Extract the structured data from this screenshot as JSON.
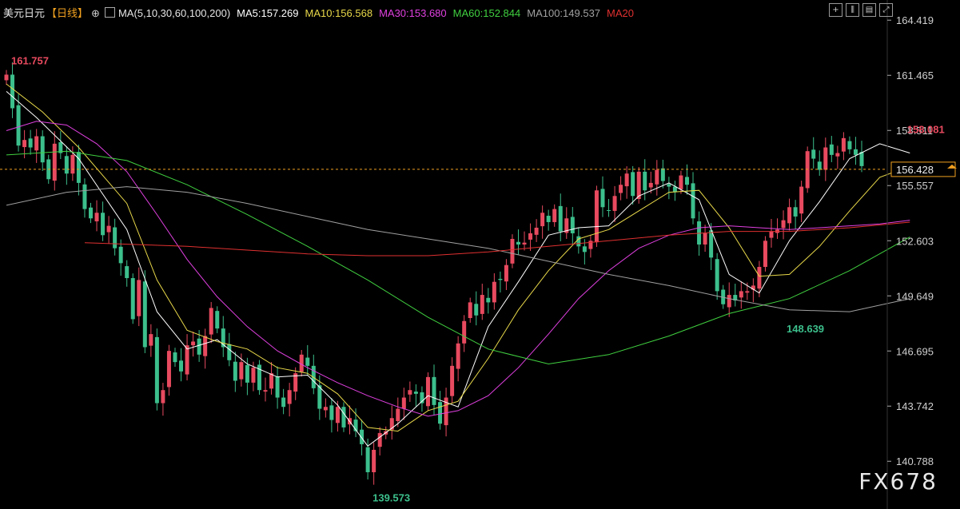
{
  "header": {
    "pair": "美元日元",
    "period": "【日线】",
    "ma_title": "MA(5,10,30,60,100,200)",
    "ma_values": [
      {
        "label": "MA5:157.269",
        "color": "#ffffff"
      },
      {
        "label": "MA10:156.568",
        "color": "#e8d84a"
      },
      {
        "label": "MA30:153.680",
        "color": "#e040e0"
      },
      {
        "label": "MA60:152.844",
        "color": "#40d040"
      },
      {
        "label": "MA100:149.537",
        "color": "#a0a0a0"
      },
      {
        "label": "MA20",
        "color": "#e03030"
      }
    ]
  },
  "toolbar": [
    "plus-square-icon",
    "bars-icon",
    "chart-icon",
    "expand-icon"
  ],
  "watermark": "FX678",
  "colors": {
    "up": "#e84a5f",
    "down": "#3cbf8c",
    "price_line": "#f0a020",
    "bg": "#000000"
  },
  "chart_data": {
    "type": "candlestick",
    "ylim": [
      139.3,
      164.9
    ],
    "y_ticks": [
      "164.419",
      "161.465",
      "158.511",
      "155.557",
      "152.603",
      "149.649",
      "146.695",
      "143.742",
      "140.788"
    ],
    "current_price": "156.428",
    "annotations": [
      {
        "text": "161.757",
        "value": 161.757,
        "index": 0,
        "color": "#e84a5f"
      },
      {
        "text": "139.573",
        "value": 139.573,
        "index": 60,
        "color": "#3cbf8c"
      },
      {
        "text": "148.639",
        "value": 148.639,
        "index": 129,
        "color": "#3cbf8c"
      },
      {
        "text": "158.081",
        "value": 158.081,
        "index": 149,
        "color": "#e84a5f"
      }
    ],
    "closes": [
      161.5,
      159.7,
      157.7,
      158.0,
      157.6,
      158.2,
      156.8,
      155.9,
      157.8,
      157.3,
      156.2,
      157.2,
      155.7,
      154.3,
      153.8,
      154.1,
      152.9,
      153.4,
      152.2,
      151.4,
      150.6,
      148.4,
      150.5,
      146.9,
      147.6,
      143.9,
      144.6,
      146.7,
      146.1,
      145.6,
      147.0,
      147.2,
      146.5,
      147.5,
      149.0,
      147.9,
      146.9,
      146.2,
      145.1,
      146.1,
      145.0,
      145.8,
      144.6,
      144.6,
      145.5,
      144.2,
      143.7,
      144.6,
      145.5,
      146.5,
      145.9,
      144.7,
      143.6,
      143.7,
      143.0,
      143.7,
      142.6,
      143.1,
      142.4,
      141.7,
      140.2,
      141.4,
      142.3,
      142.4,
      143.1,
      143.6,
      144.2,
      144.6,
      144.4,
      143.9,
      145.3,
      143.8,
      142.8,
      144.2,
      145.9,
      147.1,
      148.3,
      149.3,
      148.6,
      149.7,
      149.3,
      150.4,
      150.5,
      151.3,
      152.7,
      152.4,
      152.5,
      153.0,
      153.3,
      154.1,
      153.6,
      154.3,
      153.1,
      153.8,
      153.0,
      152.3,
      152.0,
      152.6,
      155.3,
      154.4,
      154.2,
      155.0,
      155.6,
      156.2,
      155.0,
      156.3,
      155.3,
      155.7,
      156.4,
      155.8,
      155.5,
      155.2,
      156.1,
      155.6,
      153.8,
      152.4,
      153.0,
      151.7,
      149.9,
      149.2,
      149.7,
      149.4,
      149.9,
      149.9,
      150.2,
      151.2,
      152.6,
      153.1,
      153.2,
      153.7,
      154.4,
      153.9,
      155.5,
      157.4,
      157.0,
      156.4,
      157.6,
      157.2,
      157.3,
      158.1,
      157.5,
      157.2,
      156.6
    ],
    "ma_series": [
      {
        "name": "MA5",
        "color": "#ffffff",
        "points": [
          [
            0,
            160.6
          ],
          [
            5,
            159.2
          ],
          [
            12,
            157.0
          ],
          [
            20,
            153.2
          ],
          [
            25,
            148.8
          ],
          [
            30,
            146.8
          ],
          [
            35,
            147.3
          ],
          [
            40,
            146.0
          ],
          [
            45,
            145.3
          ],
          [
            50,
            145.4
          ],
          [
            55,
            143.8
          ],
          [
            60,
            141.6
          ],
          [
            65,
            142.8
          ],
          [
            70,
            144.3
          ],
          [
            75,
            143.7
          ],
          [
            80,
            148.0
          ],
          [
            85,
            150.4
          ],
          [
            90,
            152.9
          ],
          [
            95,
            153.3
          ],
          [
            100,
            153.4
          ],
          [
            105,
            155.0
          ],
          [
            110,
            155.7
          ],
          [
            115,
            154.8
          ],
          [
            120,
            150.8
          ],
          [
            125,
            149.8
          ],
          [
            130,
            152.6
          ],
          [
            135,
            154.7
          ],
          [
            140,
            157.0
          ],
          [
            145,
            157.8
          ],
          [
            150,
            157.3
          ]
        ]
      },
      {
        "name": "MA10",
        "color": "#e8d84a",
        "points": [
          [
            0,
            161.0
          ],
          [
            6,
            159.5
          ],
          [
            12,
            157.6
          ],
          [
            20,
            154.6
          ],
          [
            25,
            150.5
          ],
          [
            30,
            147.8
          ],
          [
            35,
            147.2
          ],
          [
            40,
            146.8
          ],
          [
            45,
            145.8
          ],
          [
            50,
            145.5
          ],
          [
            55,
            144.4
          ],
          [
            60,
            142.6
          ],
          [
            65,
            142.4
          ],
          [
            70,
            143.5
          ],
          [
            75,
            144.0
          ],
          [
            80,
            146.3
          ],
          [
            85,
            148.9
          ],
          [
            90,
            151.0
          ],
          [
            95,
            152.7
          ],
          [
            100,
            153.2
          ],
          [
            105,
            154.2
          ],
          [
            110,
            155.2
          ],
          [
            115,
            155.3
          ],
          [
            120,
            153.3
          ],
          [
            125,
            150.7
          ],
          [
            130,
            150.8
          ],
          [
            135,
            152.3
          ],
          [
            140,
            154.2
          ],
          [
            145,
            156.0
          ],
          [
            150,
            156.6
          ]
        ]
      },
      {
        "name": "MA30",
        "color": "#e040e0",
        "points": [
          [
            0,
            158.5
          ],
          [
            5,
            159.0
          ],
          [
            10,
            158.8
          ],
          [
            15,
            157.8
          ],
          [
            20,
            156.3
          ],
          [
            25,
            154.0
          ],
          [
            30,
            151.6
          ],
          [
            35,
            149.6
          ],
          [
            40,
            148.0
          ],
          [
            45,
            146.7
          ],
          [
            50,
            145.8
          ],
          [
            55,
            145.0
          ],
          [
            60,
            144.3
          ],
          [
            65,
            143.7
          ],
          [
            70,
            143.2
          ],
          [
            75,
            143.5
          ],
          [
            80,
            144.3
          ],
          [
            85,
            145.8
          ],
          [
            90,
            147.6
          ],
          [
            95,
            149.5
          ],
          [
            100,
            151.0
          ],
          [
            105,
            152.2
          ],
          [
            110,
            152.9
          ],
          [
            115,
            153.3
          ],
          [
            120,
            153.4
          ],
          [
            125,
            153.3
          ],
          [
            130,
            153.2
          ],
          [
            135,
            153.3
          ],
          [
            140,
            153.4
          ],
          [
            145,
            153.5
          ],
          [
            150,
            153.7
          ]
        ]
      },
      {
        "name": "MA60",
        "color": "#40d040",
        "points": [
          [
            0,
            157.2
          ],
          [
            10,
            157.4
          ],
          [
            20,
            156.9
          ],
          [
            30,
            155.6
          ],
          [
            40,
            154.0
          ],
          [
            50,
            152.3
          ],
          [
            60,
            150.5
          ],
          [
            70,
            148.5
          ],
          [
            80,
            146.8
          ],
          [
            90,
            146.0
          ],
          [
            100,
            146.5
          ],
          [
            110,
            147.5
          ],
          [
            120,
            148.7
          ],
          [
            130,
            149.5
          ],
          [
            140,
            151.0
          ],
          [
            150,
            152.8
          ]
        ]
      },
      {
        "name": "MA100",
        "color": "#a0a0a0",
        "points": [
          [
            0,
            154.5
          ],
          [
            10,
            155.2
          ],
          [
            20,
            155.5
          ],
          [
            30,
            155.2
          ],
          [
            40,
            154.6
          ],
          [
            50,
            153.9
          ],
          [
            60,
            153.2
          ],
          [
            70,
            152.7
          ],
          [
            80,
            152.2
          ],
          [
            90,
            151.5
          ],
          [
            100,
            150.8
          ],
          [
            110,
            150.2
          ],
          [
            120,
            149.5
          ],
          [
            130,
            148.9
          ],
          [
            140,
            148.8
          ],
          [
            150,
            149.5
          ]
        ]
      },
      {
        "name": "MA20",
        "color": "#e03030",
        "points": [
          [
            13,
            152.5
          ],
          [
            30,
            152.3
          ],
          [
            40,
            152.1
          ],
          [
            50,
            151.9
          ],
          [
            60,
            151.8
          ],
          [
            70,
            151.8
          ],
          [
            80,
            152.0
          ],
          [
            90,
            152.3
          ],
          [
            100,
            152.6
          ],
          [
            110,
            152.9
          ],
          [
            120,
            153.1
          ],
          [
            130,
            153.1
          ],
          [
            140,
            153.3
          ],
          [
            150,
            153.6
          ]
        ]
      }
    ]
  }
}
